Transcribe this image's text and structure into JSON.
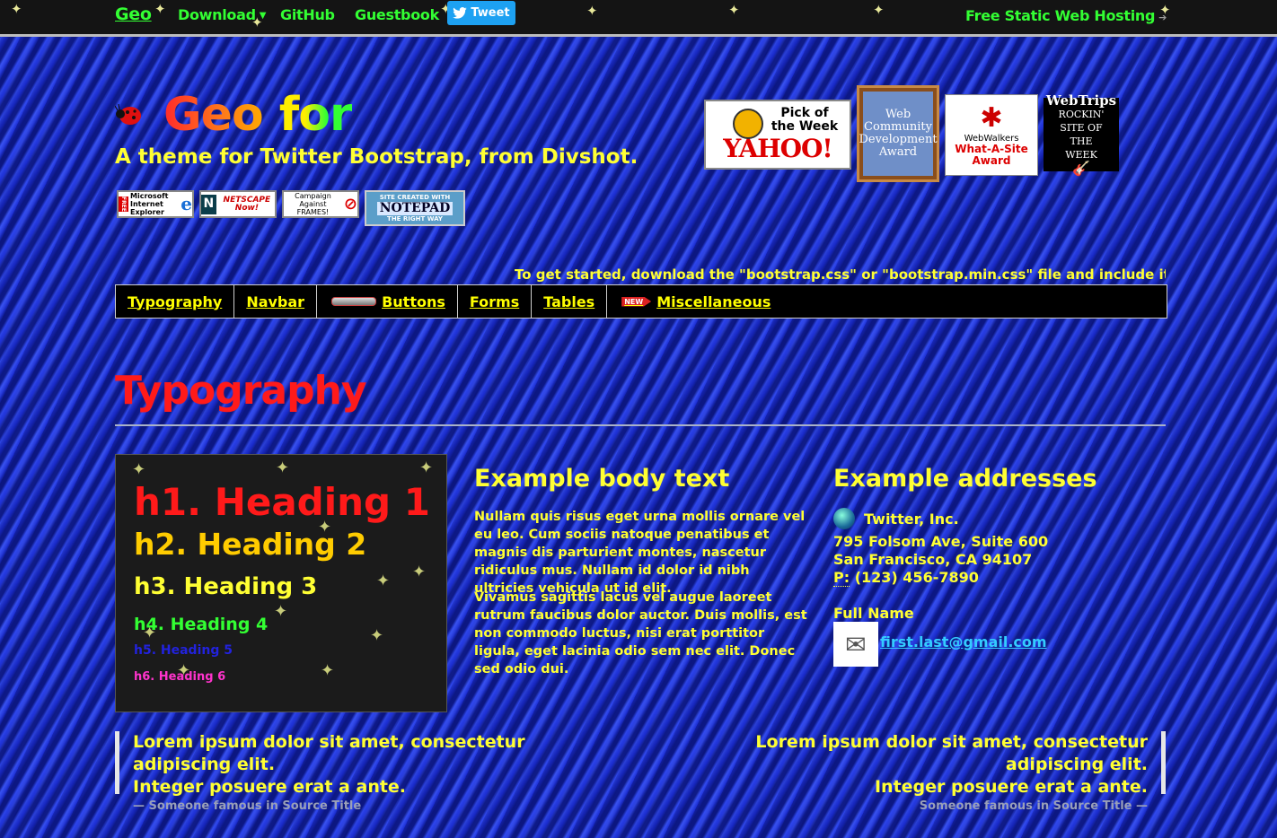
{
  "navbar": {
    "brand": "Geo",
    "download": "Download",
    "github": "GitHub",
    "guestbook": "Guestbook",
    "tweet": "Tweet",
    "hosting": "Free Static Web Hosting"
  },
  "header": {
    "title_word1": "Geo",
    "title_word2": "for",
    "subtitle": "A theme for Twitter Bootstrap, from Divshot.",
    "badges": {
      "ie": "Microsoft Internet Explorer",
      "netscape": "NETSCAPE Now!",
      "frames": "Campaign Against FRAMES!",
      "notepad_top": "SITE CREATED WITH",
      "notepad_mid": "NOTEPAD",
      "notepad_bot": "THE RIGHT WAY"
    },
    "awards": {
      "yahoo_line1": "Pick of",
      "yahoo_line2": "the Week",
      "yahoo_logo": "YAHOO!",
      "wcd": "Web Community Development Award",
      "ww_line1": "WebWalkers",
      "ww_line2": "What-A-Site Award",
      "wt_title": "WebTrips",
      "wt_line": "ROCKIN' SITE OF THE WEEK"
    },
    "marquee": "To get started, download the \"bootstrap.css\" or \"bootstrap.min.css\" file and include it in your HT"
  },
  "subnav": {
    "typography": "Typography",
    "navbar": "Navbar",
    "buttons": "Buttons",
    "forms": "Forms",
    "tables": "Tables",
    "new_label": "NEW",
    "misc": "Miscellaneous"
  },
  "typography": {
    "section_title": "Typography",
    "h1": "h1. Heading 1",
    "h2": "h2. Heading 2",
    "h3": "h3. Heading 3",
    "h4": "h4. Heading 4",
    "h5": "h5. Heading 5",
    "h6": "h6. Heading 6",
    "body_title": "Example body text",
    "body_p1": "Nullam quis risus eget urna mollis ornare vel eu leo. Cum sociis natoque penatibus et magnis dis parturient montes, nascetur ridiculus mus. Nullam id dolor id nibh ultricies vehicula ut id elit.",
    "body_p2": "Vivamus sagittis lacus vel augue laoreet rutrum faucibus dolor auctor. Duis mollis, est non commodo luctus, nisi erat porttitor ligula, eget lacinia odio sem nec elit. Donec sed odio dui.",
    "addr_title": "Example addresses",
    "company": "Twitter, Inc.",
    "street": "795 Folsom Ave, Suite 600",
    "city": "San Francisco, CA 94107",
    "phone_label": "P:",
    "phone": "(123) 456-7890",
    "full_name": "Full Name",
    "email": "first.last@gmail.com"
  },
  "quotes": {
    "left_line1": "Lorem ipsum dolor sit amet, consectetur adipiscing elit.",
    "left_line2": "Integer posuere erat a ante.",
    "left_source": "— Someone famous in Source Title",
    "right_line1": "Lorem ipsum dolor sit amet, consectetur adipiscing elit.",
    "right_line2": "Integer posuere erat a ante.",
    "right_source": "Someone famous in Source Title —"
  },
  "colors": {
    "nav_green": "#33ff33",
    "text_yellow": "#ffff33",
    "heading_red": "#ff1a1a",
    "link_blue": "#33ccff",
    "background_blue": "#1d2fd6"
  }
}
